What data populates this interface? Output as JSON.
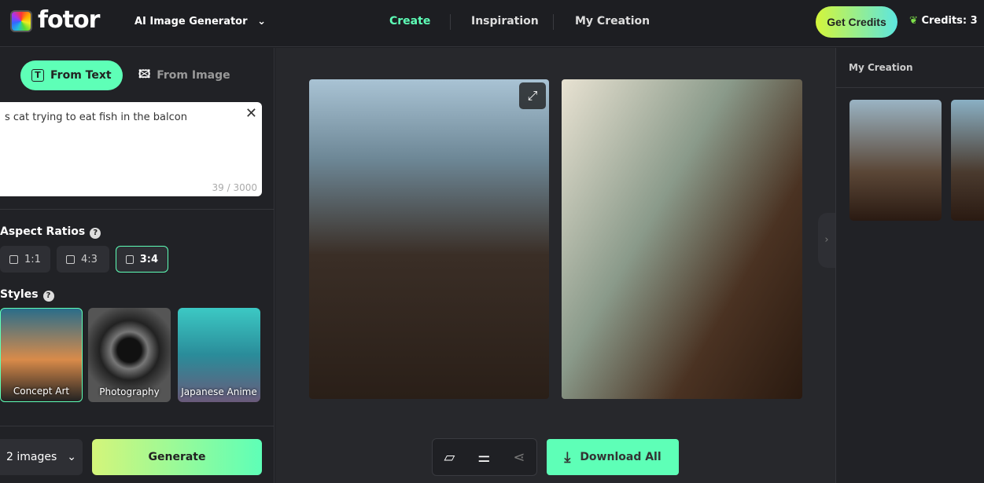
{
  "header": {
    "logo": "fotor",
    "tool": "AI Image Generator",
    "nav": [
      "Create",
      "Inspiration",
      "My Creation"
    ],
    "get_credits": "Get Credits",
    "credits": "Credits: 3"
  },
  "left": {
    "tabs": [
      "From Text",
      "From Image"
    ],
    "prompt": "s cat trying to eat fish in the balcon",
    "counter": "39 / 3000",
    "aspect_title": "Aspect Ratios",
    "aspects": [
      "1:1",
      "4:3",
      "3:4"
    ],
    "aspect_selected": "3:4",
    "styles_title": "Styles",
    "styles": [
      "Concept Art",
      "Photography",
      "Japanese Anime"
    ],
    "style_selected": "Concept Art",
    "count": "2 images",
    "generate": "Generate"
  },
  "center": {
    "download": "Download All"
  },
  "right": {
    "title": "My Creation"
  },
  "colors": {
    "accent": "#5effb7",
    "bg": "#1d1e22"
  }
}
